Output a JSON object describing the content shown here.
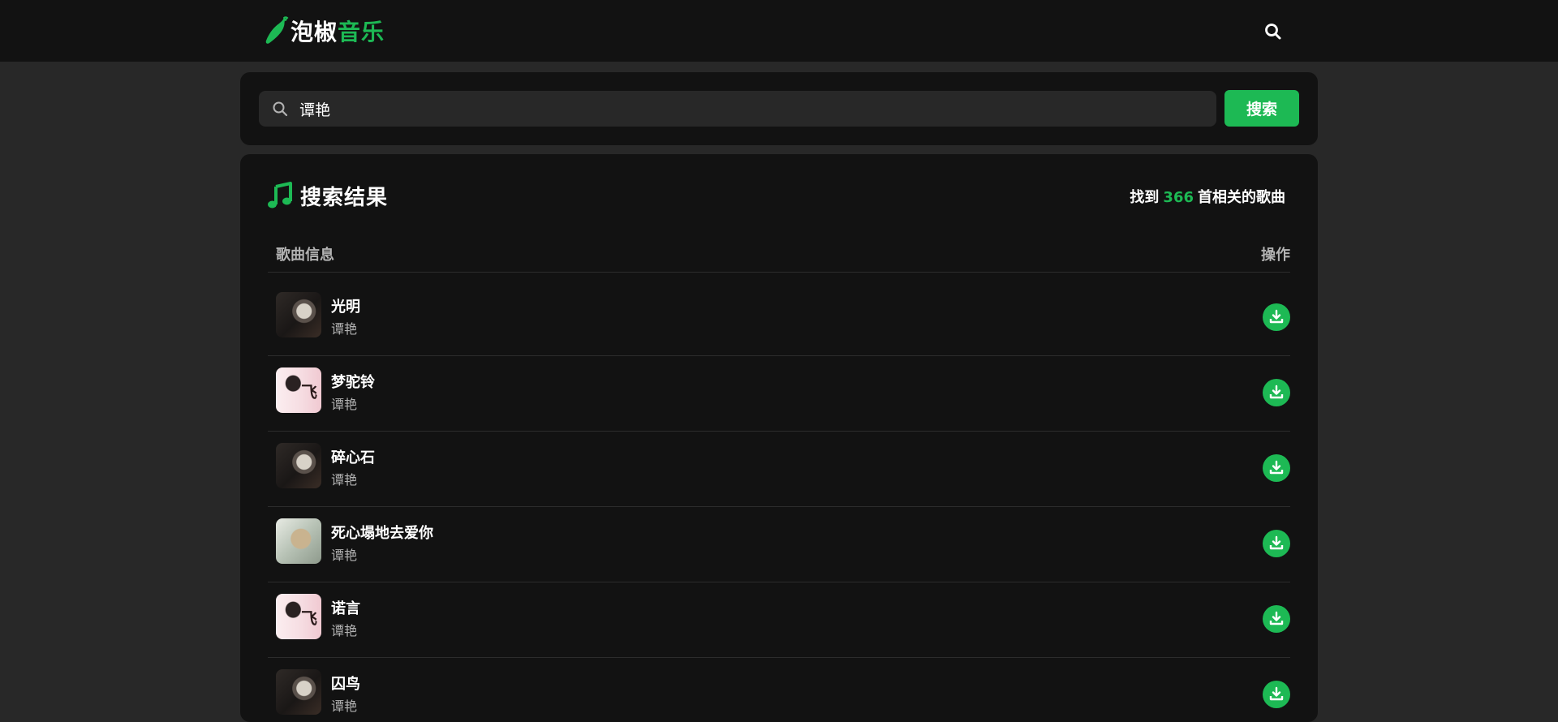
{
  "header": {
    "logo_text_white": "泡椒",
    "logo_text_green": "音乐",
    "logo_icon": "chili-pepper-icon",
    "search_icon": "search-icon"
  },
  "search": {
    "value": "谭艳",
    "button_label": "搜索"
  },
  "results": {
    "title": "搜索结果",
    "title_icon": "music-note-icon",
    "count_prefix": "找到",
    "count": "366",
    "count_suffix": "首相关的歌曲",
    "col_info": "歌曲信息",
    "col_action": "操作",
    "songs": [
      {
        "title": "光明",
        "artist": "谭艳"
      },
      {
        "title": "梦驼铃",
        "artist": "谭艳"
      },
      {
        "title": "碎心石",
        "artist": "谭艳"
      },
      {
        "title": "死心塌地去爱你",
        "artist": "谭艳"
      },
      {
        "title": "诺言",
        "artist": "谭艳"
      },
      {
        "title": "囚鸟",
        "artist": "谭艳"
      }
    ]
  },
  "colors": {
    "accent": "#1db954",
    "background": "#282828",
    "card": "#121212"
  }
}
